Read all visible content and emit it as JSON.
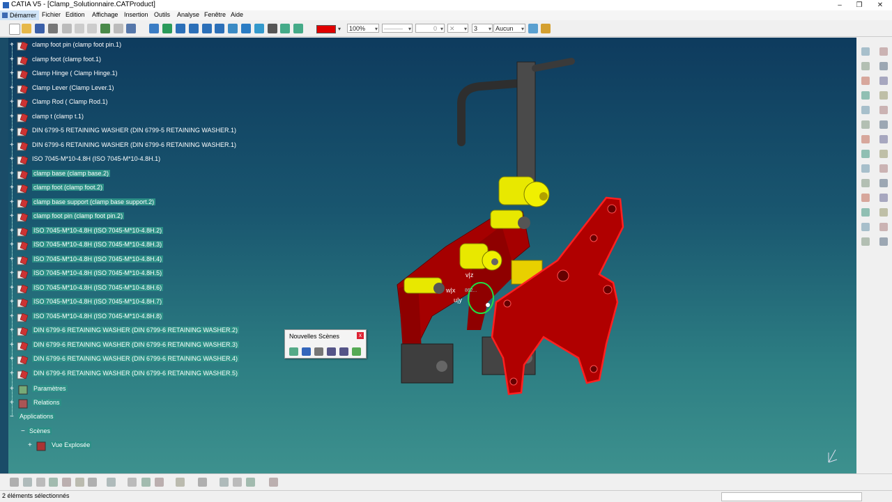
{
  "window": {
    "title": "CATIA V5 - [Clamp_Solutionnaire.CATProduct]",
    "controls": [
      "–",
      "❐",
      "✕"
    ]
  },
  "menu": {
    "start": "Démarrer",
    "items": [
      "Fichier",
      "Edition",
      "Affichage",
      "Insertion",
      "Outils",
      "Analyse",
      "Fenêtre",
      "Aide"
    ]
  },
  "toolbar": {
    "color_hex": "#e00000",
    "zoom": "100%",
    "line_type": "———",
    "line_weight": "0",
    "layer_num": "3",
    "layer": "Aucun"
  },
  "tree": {
    "items": [
      {
        "label": "clamp foot pin (clamp foot pin.1)",
        "selected": false
      },
      {
        "label": "clamp foot (clamp foot.1)",
        "selected": false
      },
      {
        "label": " Clamp Hinge ( Clamp Hinge.1)",
        "selected": false
      },
      {
        "label": "Clamp Lever (Clamp Lever.1)",
        "selected": false
      },
      {
        "label": " Clamp Rod ( Clamp Rod.1)",
        "selected": false
      },
      {
        "label": "clamp t (clamp t.1)",
        "selected": false
      },
      {
        "label": "DIN 6799-5 RETAINING WASHER (DIN 6799-5 RETAINING WASHER.1)",
        "selected": false
      },
      {
        "label": "DIN 6799-6 RETAINING WASHER (DIN 6799-6 RETAINING WASHER.1)",
        "selected": false
      },
      {
        "label": "ISO 7045-M*10-4.8H (ISO 7045-M*10-4.8H.1)",
        "selected": false
      },
      {
        "label": "clamp base (clamp base.2)",
        "selected": true
      },
      {
        "label": "clamp foot (clamp foot.2)",
        "selected": true
      },
      {
        "label": "clamp base support (clamp base support.2)",
        "selected": true
      },
      {
        "label": "clamp foot pin (clamp foot pin.2)",
        "selected": true
      },
      {
        "label": "ISO 7045-M*10-4.8H (ISO 7045-M*10-4.8H.2)",
        "selected": true
      },
      {
        "label": "ISO 7045-M*10-4.8H (ISO 7045-M*10-4.8H.3)",
        "selected": true
      },
      {
        "label": "ISO 7045-M*10-4.8H (ISO 7045-M*10-4.8H.4)",
        "selected": true
      },
      {
        "label": "ISO 7045-M*10-4.8H (ISO 7045-M*10-4.8H.5)",
        "selected": true
      },
      {
        "label": "ISO 7045-M*10-4.8H (ISO 7045-M*10-4.8H.6)",
        "selected": true
      },
      {
        "label": "ISO 7045-M*10-4.8H (ISO 7045-M*10-4.8H.7)",
        "selected": true
      },
      {
        "label": "ISO 7045-M*10-4.8H (ISO 7045-M*10-4.8H.8)",
        "selected": true
      },
      {
        "label": "DIN 6799-6 RETAINING WASHER (DIN 6799-6 RETAINING WASHER.2)",
        "selected": true
      },
      {
        "label": "DIN 6799-6 RETAINING WASHER (DIN 6799-6 RETAINING WASHER.3)",
        "selected": true
      },
      {
        "label": "DIN 6799-6 RETAINING WASHER (DIN 6799-6 RETAINING WASHER.4)",
        "selected": true
      },
      {
        "label": "DIN 6799-6 RETAINING WASHER (DIN 6799-6 RETAINING WASHER.5)",
        "selected": true
      }
    ],
    "parametres": "Paramètres",
    "relations": "Relations",
    "applications": "Applications",
    "scenes": "Scènes",
    "vue_explosee": "Vue Explosée"
  },
  "scene_panel": {
    "title": "Nouvelles Scènes",
    "close": "x"
  },
  "axes": {
    "vz": "v|z",
    "wx": "w|x",
    "uy": "u|y",
    "value": "862..."
  },
  "status": {
    "text": "2 éléments sélectionnés"
  },
  "icons": {
    "part": "part-icon",
    "params": "parameters-icon",
    "relations": "relations-icon",
    "compass": "compass-icon"
  },
  "colors": {
    "tree_highlight": "#2c8f86",
    "part_red": "#b30000",
    "part_yellow": "#e8e800",
    "part_gray": "#4a4a4a"
  }
}
